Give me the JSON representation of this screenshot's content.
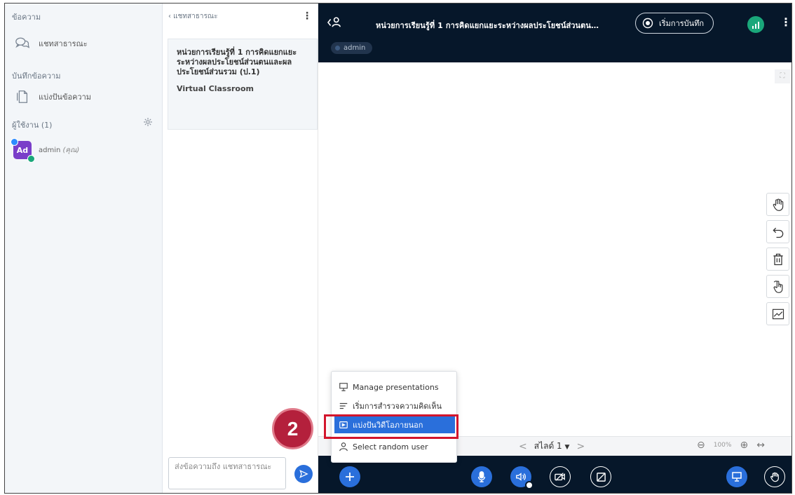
{
  "sidebar": {
    "messages_title": "ข้อความ",
    "public_chat": "แชทสาธารณะ",
    "notes_title": "บันทึกข้อความ",
    "shared_notes": "แบ่งปันข้อความ",
    "users_title": "ผู้ใช้งาน (1)",
    "user_initials": "Ad",
    "user_name": "admin",
    "user_you": "(คุณ)"
  },
  "chat": {
    "back_label": "‹ แชทสาธารณะ",
    "welcome_title": "หน่วยการเรียนรู้ที่ 1 การคิดแยกแยะระหว่างผลประโยชน์ส่วนตนและผลประโยชน์ส่วนรวม (ป.1)",
    "welcome_subtitle": "Virtual Classroom",
    "input_placeholder": "ส่งข้อความถึง แชทสาธารณะ"
  },
  "header": {
    "title": "หน่วยการเรียนรู้ที่ 1 การคิดแยกแยะระหว่างผลประโยชน์ส่วนตน…",
    "record_label": "เริ่มการบันทึก",
    "talking_user": "admin"
  },
  "slide_controls": {
    "slide_label": "สไลด์ 1",
    "zoom": "100%"
  },
  "popup_menu": {
    "items": [
      {
        "label": "Manage presentations",
        "icon": "presentation-icon"
      },
      {
        "label": "เริ่มการสำรวจความคิดเห็น",
        "icon": "poll-icon"
      },
      {
        "label": "แบ่งปันวิดีโอภายนอก",
        "icon": "external-video-icon"
      },
      {
        "label": "Select random user",
        "icon": "user-icon"
      }
    ],
    "selected_index": 2
  },
  "annotation": {
    "step_number": "2"
  },
  "colors": {
    "accent": "#2a6fdb",
    "topbar": "#06172a",
    "highlight": "#d3152c",
    "badge": "#b4203c"
  }
}
